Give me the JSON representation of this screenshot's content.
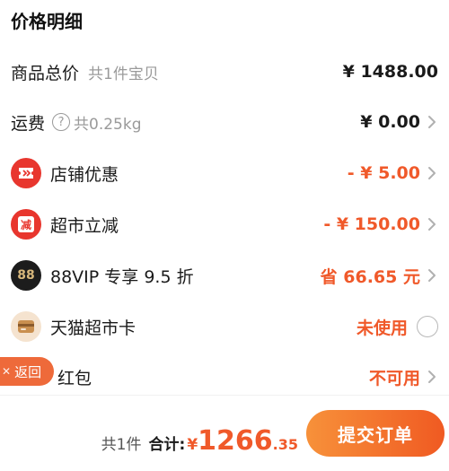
{
  "title": "价格明细",
  "rows": {
    "goods": {
      "label": "商品总价",
      "sub": "共1件宝贝",
      "value": "¥ 1488.00"
    },
    "shipping": {
      "label": "运费",
      "help": "?",
      "sub": "共0.25kg",
      "value": "¥ 0.00"
    },
    "store": {
      "label": "店铺优惠",
      "value": "- ¥ 5.00",
      "icon": "store-coupon-icon"
    },
    "market": {
      "label": "超市立减",
      "value": "- ¥ 150.00",
      "icon_text": "减"
    },
    "vip": {
      "label": "88VIP 专享 9.5 折",
      "value": "省 66.65 元",
      "icon_text": "88"
    },
    "card": {
      "label": "天猫超市卡",
      "value": "未使用",
      "icon": "card-icon"
    },
    "redpacket": {
      "label": "红包",
      "value": "不可用"
    }
  },
  "back_label": "返回",
  "bottom": {
    "count": "共1件",
    "total_label": "合计:",
    "currency": "¥",
    "total_int": "1266",
    "total_dec": ".35",
    "submit_label": "提交订单"
  },
  "colors": {
    "accent": "#f0592a",
    "red": "#e8362e",
    "vip_bg": "#1c1c1c",
    "vip_gold": "#d7b77b"
  }
}
